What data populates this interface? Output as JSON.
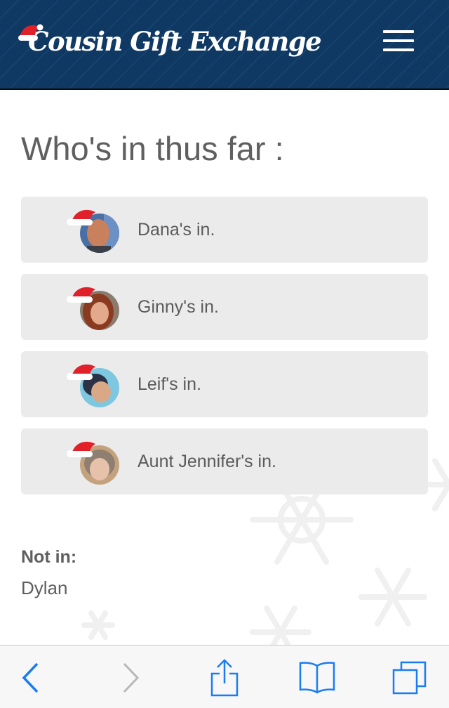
{
  "header": {
    "app_title": "Cousin Gift Exchange",
    "menu_icon": "hamburger-menu-icon",
    "background_color": "#0f3863"
  },
  "main": {
    "title": "Who's in thus far :",
    "participants": [
      {
        "label": "Dana's in.",
        "avatar_icon": "avatar-dana"
      },
      {
        "label": "Ginny's in.",
        "avatar_icon": "avatar-ginny"
      },
      {
        "label": "Leif's in.",
        "avatar_icon": "avatar-leif"
      },
      {
        "label": "Aunt Jennifer's in.",
        "avatar_icon": "avatar-aunt-jennifer"
      }
    ],
    "not_in": {
      "label": "Not in:",
      "names": [
        "Dylan"
      ]
    }
  },
  "toolbar": {
    "back_icon": "chevron-left-icon",
    "forward_icon": "chevron-right-icon",
    "share_icon": "share-icon",
    "bookmarks_icon": "book-icon",
    "tabs_icon": "tabs-icon",
    "accent_color": "#1a7cf5",
    "disabled_color": "#b8b8bc"
  },
  "colors": {
    "row_background": "#ebebeb",
    "text": "#5f5f5f",
    "santa_hat_red": "#e0212a"
  }
}
